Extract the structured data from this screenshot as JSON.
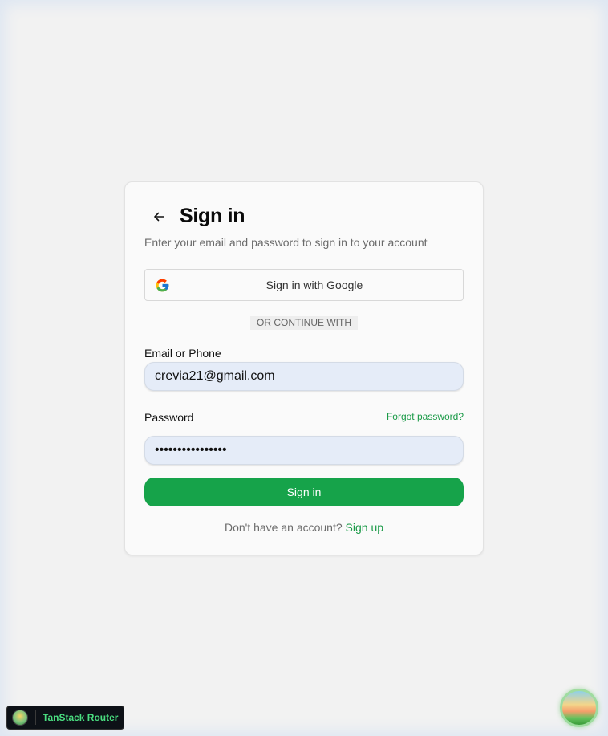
{
  "header": {
    "title": "Sign in",
    "subtitle": "Enter your email and password to sign in to your account"
  },
  "google": {
    "label": "Sign in with Google"
  },
  "divider": {
    "text": "OR CONTINUE WITH"
  },
  "email": {
    "label": "Email or Phone",
    "value": "crevia21@gmail.com"
  },
  "password": {
    "label": "Password",
    "value": "................",
    "forgot_label": "Forgot password?"
  },
  "submit": {
    "label": "Sign in"
  },
  "signup": {
    "prompt": "Don't have an account?",
    "link_label": "Sign up"
  },
  "devtools": {
    "badge_label": "TanStack Router"
  },
  "colors": {
    "accent": "#16a34a",
    "link": "#1a9a47",
    "input_bg": "#e5ecf8"
  },
  "icons": {
    "back": "arrow-left-icon",
    "google": "google-icon",
    "logo": "tanstack-logo-icon"
  }
}
